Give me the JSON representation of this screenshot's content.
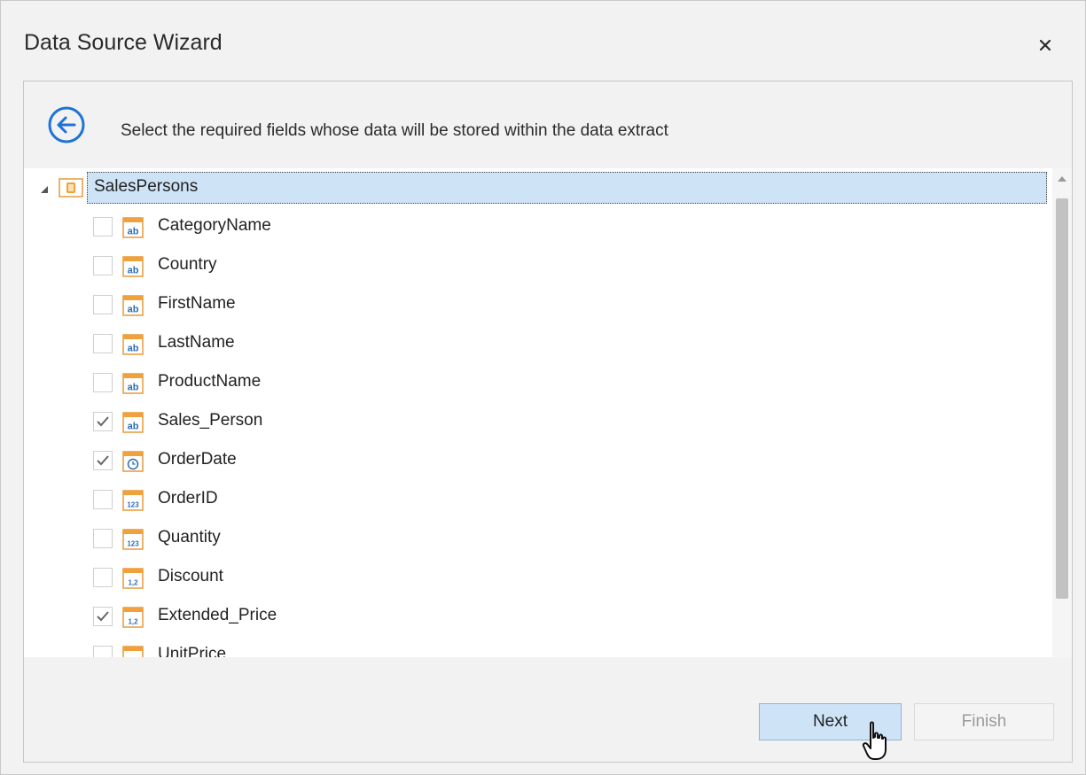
{
  "window": {
    "title": "Data Source Wizard",
    "close_icon": "close-icon"
  },
  "header": {
    "instruction": "Select the required fields whose data will be stored within the data extract",
    "back_icon": "back-arrow-icon"
  },
  "tree": {
    "root": {
      "label": "SalesPersons",
      "expanded": true,
      "icon": "database-table-icon"
    },
    "fields": [
      {
        "label": "CategoryName",
        "checked": false,
        "type": "string"
      },
      {
        "label": "Country",
        "checked": false,
        "type": "string"
      },
      {
        "label": "FirstName",
        "checked": false,
        "type": "string"
      },
      {
        "label": "LastName",
        "checked": false,
        "type": "string"
      },
      {
        "label": "ProductName",
        "checked": false,
        "type": "string"
      },
      {
        "label": "Sales_Person",
        "checked": true,
        "type": "string"
      },
      {
        "label": "OrderDate",
        "checked": true,
        "type": "datetime"
      },
      {
        "label": "OrderID",
        "checked": false,
        "type": "integer"
      },
      {
        "label": "Quantity",
        "checked": false,
        "type": "integer"
      },
      {
        "label": "Discount",
        "checked": false,
        "type": "decimal"
      },
      {
        "label": "Extended_Price",
        "checked": true,
        "type": "decimal"
      },
      {
        "label": "UnitPrice",
        "checked": false,
        "type": "decimal"
      }
    ],
    "icon_glyphs": {
      "string": "ab",
      "integer": "123",
      "decimal": "1,2"
    }
  },
  "buttons": {
    "next": "Next",
    "finish": "Finish"
  },
  "colors": {
    "accent": "#1e73d8",
    "selection": "#cfe3f7",
    "icon_orange": "#f0a13c"
  }
}
